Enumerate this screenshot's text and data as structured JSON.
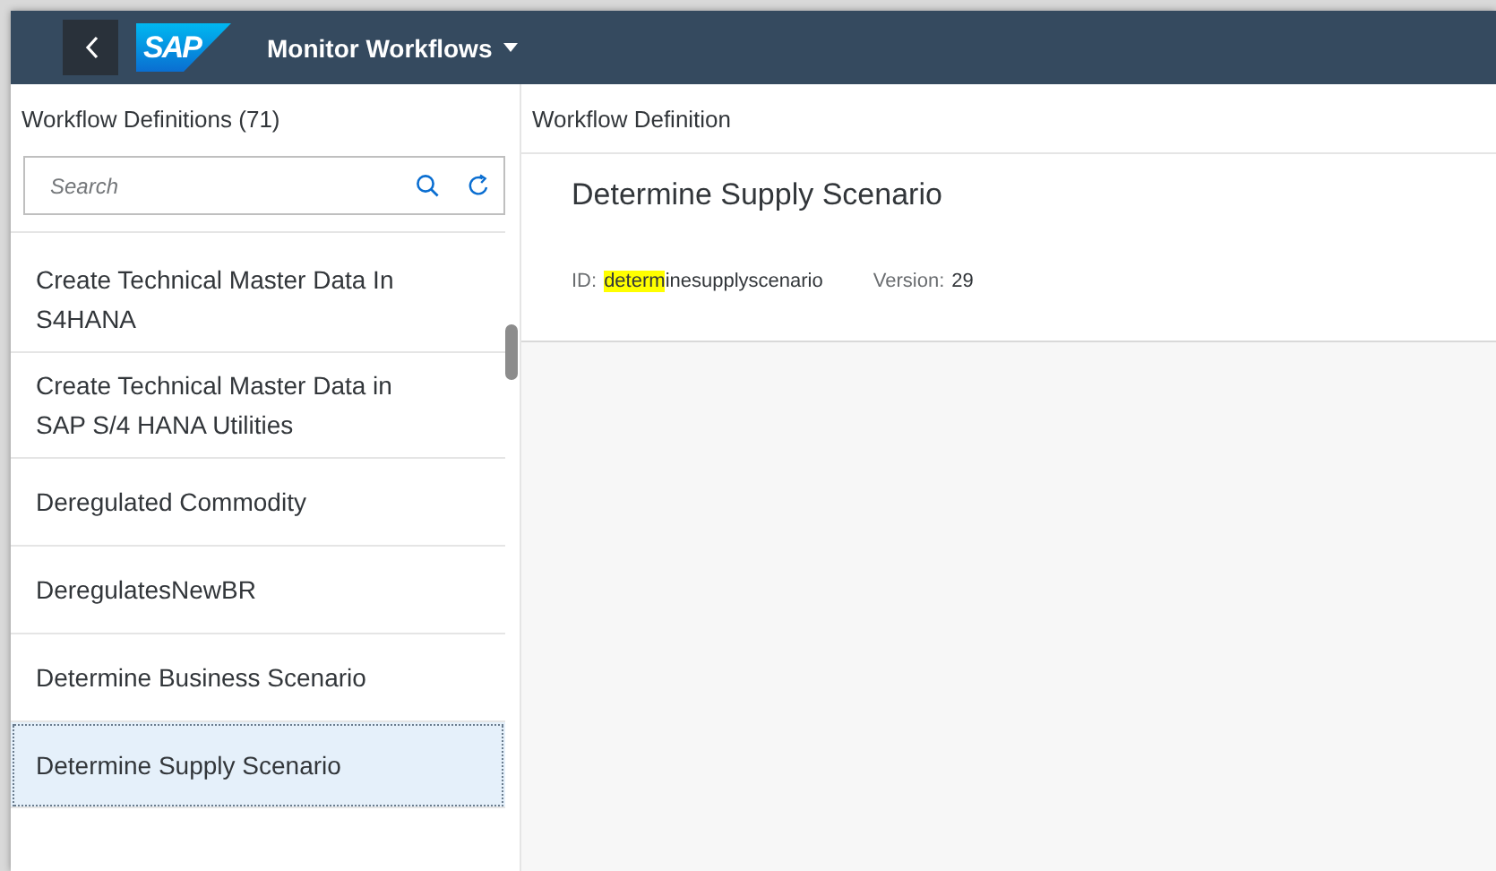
{
  "header": {
    "logo": "SAP",
    "title": "Monitor Workflows"
  },
  "master": {
    "title": "Workflow Definitions (71)",
    "search": {
      "placeholder": "Search"
    },
    "items": [
      {
        "label": "Create Technical Master Data In S4HANA",
        "selected": false
      },
      {
        "label": "Create Technical Master Data in SAP S/4 HANA Utilities",
        "selected": false
      },
      {
        "label": "Deregulated Commodity",
        "selected": false
      },
      {
        "label": "DeregulatesNewBR",
        "selected": false
      },
      {
        "label": "Determine Business Scenario",
        "selected": false
      },
      {
        "label": "Determine Supply Scenario",
        "selected": true
      }
    ]
  },
  "detail": {
    "title": "Workflow Definition",
    "heading": "Determine Supply Scenario",
    "id_label": "ID:",
    "id_value_highlighted": "determ",
    "id_value_rest": "inesupplyscenario",
    "version_label": "Version:",
    "version_value": "29"
  }
}
